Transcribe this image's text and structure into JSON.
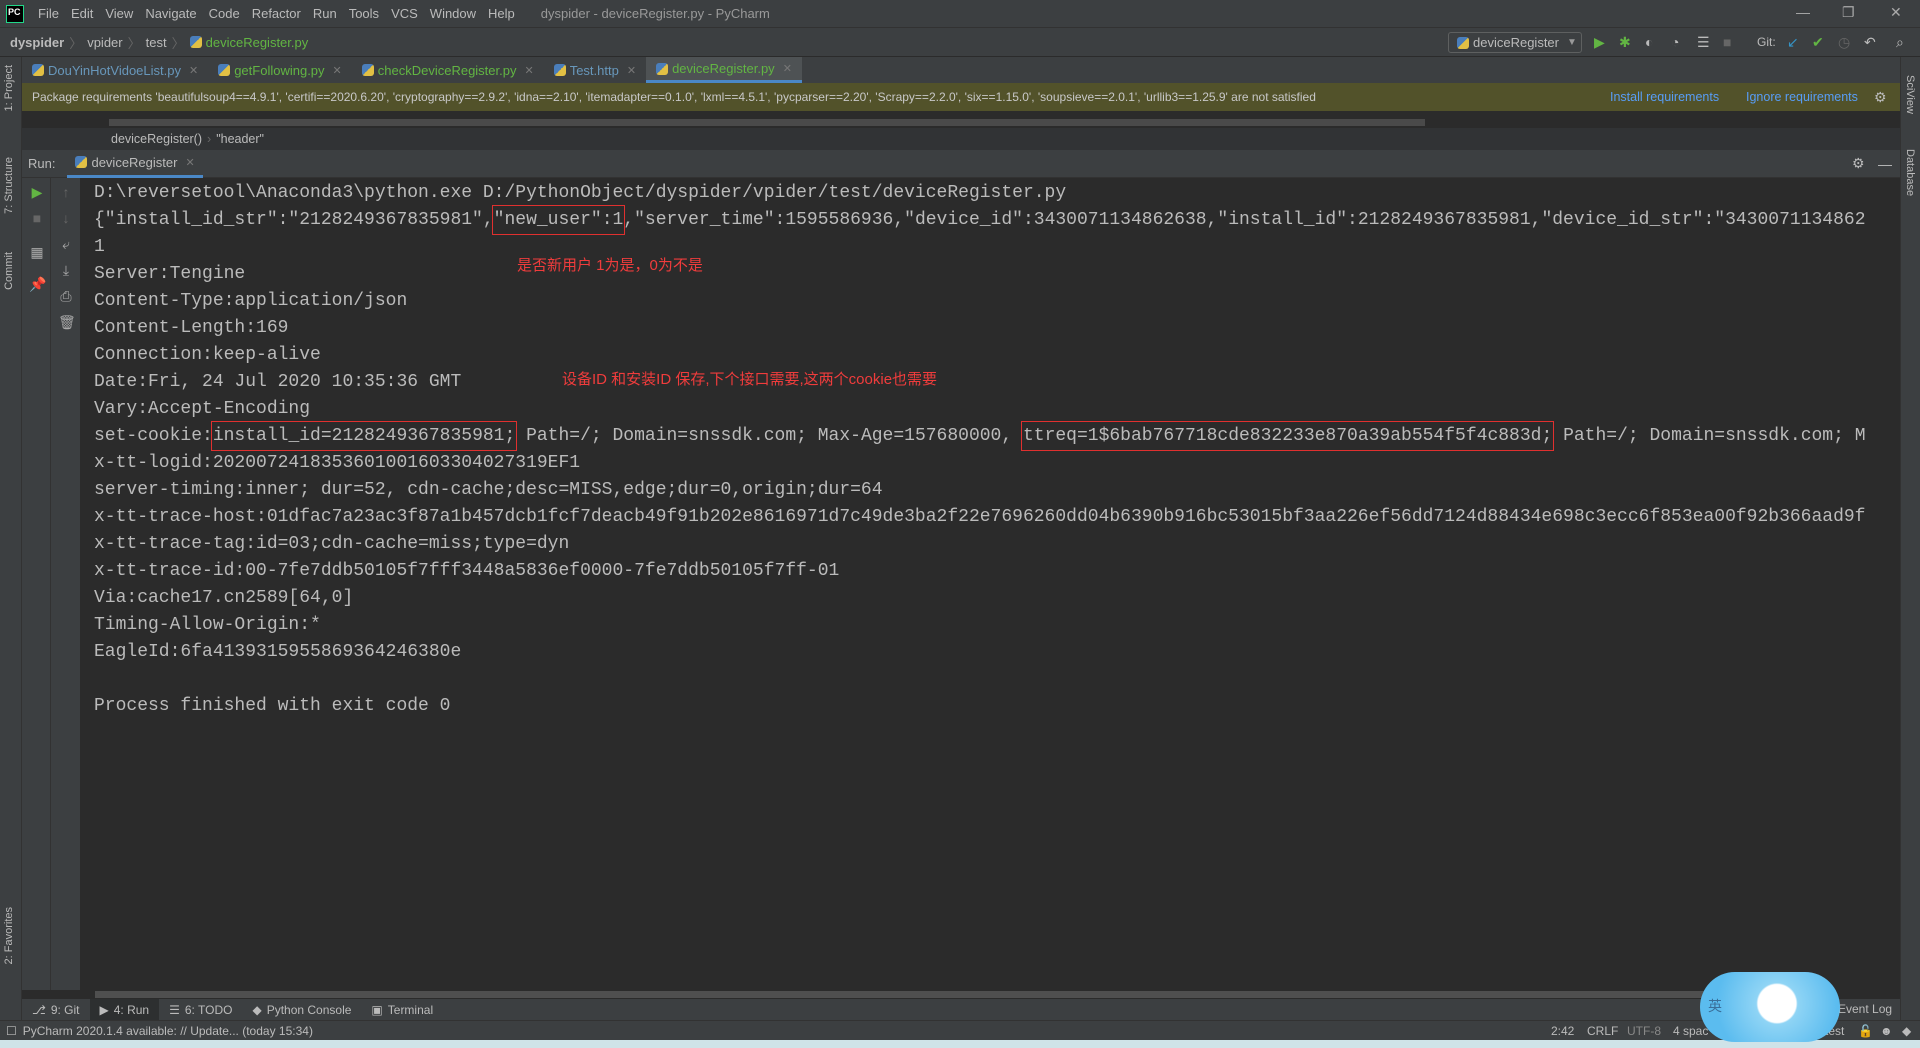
{
  "titlebar": {
    "menu": [
      "File",
      "Edit",
      "View",
      "Navigate",
      "Code",
      "Refactor",
      "Run",
      "Tools",
      "VCS",
      "Window",
      "Help"
    ],
    "title": "dyspider - deviceRegister.py - PyCharm",
    "logo": "PC"
  },
  "navbar": {
    "crumbs": [
      "dyspider",
      "vpider",
      "test",
      "deviceRegister.py"
    ],
    "run_config": "deviceRegister",
    "git_label": "Git:"
  },
  "tabs": [
    {
      "label": "DouYinHotVidoeList.py"
    },
    {
      "label": "getFollowing.py"
    },
    {
      "label": "checkDeviceRegister.py"
    },
    {
      "label": "Test.http"
    },
    {
      "label": "deviceRegister.py",
      "active": true
    }
  ],
  "package_bar": {
    "message": "Package requirements 'beautifulsoup4==4.9.1', 'certifi==2020.6.20', 'cryptography==2.9.2', 'idna==2.10', 'itemadapter==0.1.0', 'lxml==4.5.1', 'pycparser==2.20', 'Scrapy==2.2.0', 'six==1.15.0', 'soupsieve==2.0.1', 'urllib3==1.25.9' are not satisfied",
    "install": "Install requirements",
    "ignore": "Ignore requirements"
  },
  "breadcrumb": [
    "deviceRegister()",
    "\"header\""
  ],
  "run": {
    "label": "Run:",
    "tab": "deviceRegister"
  },
  "left_strip": [
    "1: Project",
    "7: Structure",
    "Commit",
    "2: Favorites"
  ],
  "right_strip": [
    "SciView",
    "Database"
  ],
  "console": [
    [
      {
        "t": "D:\\reversetool\\Anaconda3\\python.exe D:/PythonObject/dyspider/vpider/test/deviceRegister.py"
      }
    ],
    [
      {
        "t": "{\"install_id_str\":\"2128249367835981\","
      },
      {
        "t": "\"new_user\":1",
        "box": true
      },
      {
        "t": ",\"server_time\":1595586936,\"device_id\":3430071134862638,\"install_id\":2128249367835981,\"device_id_str\":\"3430071134862"
      }
    ],
    [
      {
        "t": "1"
      }
    ],
    [
      {
        "t": "Server:Tengine"
      }
    ],
    [
      {
        "t": "Content-Type:application/json"
      }
    ],
    [
      {
        "t": "Content-Length:169"
      }
    ],
    [
      {
        "t": "Connection:keep-alive"
      }
    ],
    [
      {
        "t": "Date:Fri, 24 Jul 2020 10:35:36 GMT"
      }
    ],
    [
      {
        "t": "Vary:Accept-Encoding"
      }
    ],
    [
      {
        "t": "set-cookie:"
      },
      {
        "t": "install_id=2128249367835981;",
        "box": true
      },
      {
        "t": " Path=/; Domain=snssdk.com; Max-Age=157680000, "
      },
      {
        "t": "ttreq=1$6bab767718cde832233e870a39ab554f5f4c883d;",
        "box": true
      },
      {
        "t": " Path=/; Domain=snssdk.com; M"
      }
    ],
    [
      {
        "t": "x-tt-logid:2020072418353601001603304027319EF1"
      }
    ],
    [
      {
        "t": "server-timing:inner; dur=52, cdn-cache;desc=MISS,edge;dur=0,origin;dur=64"
      }
    ],
    [
      {
        "t": "x-tt-trace-host:01dfac7a23ac3f87a1b457dcb1fcf7deacb49f91b202e8616971d7c49de3ba2f22e7696260dd04b6390b916bc53015bf3aa226ef56dd7124d88434e698c3ecc6f853ea00f92b366aad9f"
      }
    ],
    [
      {
        "t": "x-tt-trace-tag:id=03;cdn-cache=miss;type=dyn"
      }
    ],
    [
      {
        "t": "x-tt-trace-id:00-7fe7ddb50105f7fff3448a5836ef0000-7fe7ddb50105f7ff-01"
      }
    ],
    [
      {
        "t": "Via:cache17.cn2589[64,0]"
      }
    ],
    [
      {
        "t": "Timing-Allow-Origin:*"
      }
    ],
    [
      {
        "t": "EagleId:6fa4139315955869364246380e"
      }
    ],
    [
      {
        "t": ""
      }
    ],
    [
      {
        "t": "Process finished with exit code 0"
      }
    ]
  ],
  "notes": {
    "new_user": "是否新用户 1为是，0为不是",
    "cookie": "设备ID 和安装ID 保存,下个接口需要,这两个cookie也需要"
  },
  "bottom_tabs": [
    "9: Git",
    "4: Run",
    "6: TODO",
    "Python Console",
    "Terminal"
  ],
  "event_log": "Event Log",
  "status": {
    "update": "PyCharm 2020.1.4 available: // Update... (today 15:34)",
    "position": "2:42",
    "line_sep": "CRLF",
    "encoding": "UTF-8",
    "indent": "4 spac",
    "branch": "test"
  },
  "ime": "英",
  "colors": {
    "accent": "#4a88c7",
    "annotation": "#e0302f",
    "warning_bar": "#52522a",
    "run_green": "#62b543"
  }
}
